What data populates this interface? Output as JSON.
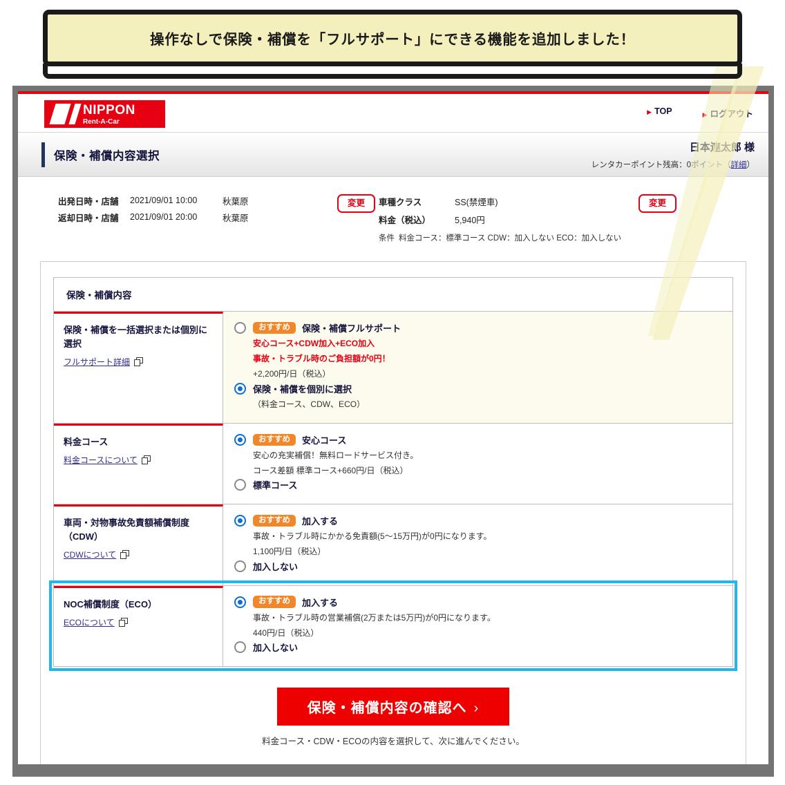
{
  "callout": {
    "text": "操作なしで保険・補償を「フルサポート」にできる機能を追加しました！"
  },
  "header": {
    "logo_line1": "NIPPON",
    "logo_line2": "Rent-A-Car",
    "nav": [
      {
        "label": "TOP"
      },
      {
        "label": "ログアウト"
      }
    ],
    "page_title": "保険・補償内容選択",
    "user_name": "日本連太郎 様",
    "point_text": "レンタカーポイント残高：0ポイント（",
    "point_link": "詳細",
    "point_text_end": "）"
  },
  "summary": {
    "departure_label": "出発日時・店舗",
    "departure_datetime": "2021/09/01 10:00",
    "departure_shop": "秋葉原",
    "return_label": "返却日時・店舗",
    "return_datetime": "2021/09/01 20:00",
    "return_shop": "秋葉原",
    "change_button_1": "変更",
    "change_button_2": "変更",
    "class_label": "車種クラス",
    "class_value": "SS(禁煙車)",
    "fee_label": "料金（税込）",
    "fee_value": "5,940円",
    "conditions_key": "条件",
    "conditions_value": "料金コース：標準コース  CDW：加入しない  ECO：加入しない"
  },
  "card": {
    "section_title": "保険・補償内容",
    "rows": [
      {
        "label_title": "保険・補償を一括選択または個別に選択",
        "link_label": "フルサポート詳細",
        "tinted": true,
        "focused": false,
        "choices": [
          {
            "selected": false,
            "badge": "おすすめ",
            "title": "保険・補償フルサポート",
            "sub": [
              {
                "text": "安心コース+CDW加入+ECO加入",
                "red": true
              },
              {
                "text": "事故・トラブル時のご負担額が0円！",
                "red": true
              },
              {
                "text": "+2,200円/日（税込）",
                "red": false
              }
            ]
          },
          {
            "selected": true,
            "badge": "",
            "title": "保険・補償を個別に選択",
            "sub": [
              {
                "text": "（料金コース、CDW、ECO）",
                "red": false
              }
            ]
          }
        ]
      },
      {
        "label_title": "料金コース",
        "link_label": "料金コースについて",
        "tinted": false,
        "focused": false,
        "choices": [
          {
            "selected": true,
            "badge": "おすすめ",
            "title": "安心コース",
            "sub": [
              {
                "text": "安心の充実補償！無料ロードサービス付き。",
                "red": false
              },
              {
                "text": "コース差額 標準コース+660円/日（税込）",
                "red": false
              }
            ]
          },
          {
            "selected": false,
            "badge": "",
            "title": "標準コース",
            "sub": []
          }
        ]
      },
      {
        "label_title": "車両・対物事故免責額補償制度（CDW）",
        "link_label": "CDWについて",
        "tinted": false,
        "focused": false,
        "choices": [
          {
            "selected": true,
            "badge": "おすすめ",
            "title": "加入する",
            "sub": [
              {
                "text": "事故・トラブル時にかかる免責額(5〜15万円)が0円になります。",
                "red": false
              },
              {
                "text": "1,100円/日（税込）",
                "red": false
              }
            ]
          },
          {
            "selected": false,
            "badge": "",
            "title": "加入しない",
            "sub": []
          }
        ]
      },
      {
        "label_title": "NOC補償制度（ECO）",
        "link_label": "ECOについて",
        "tinted": false,
        "focused": true,
        "choices": [
          {
            "selected": true,
            "badge": "おすすめ",
            "title": "加入する",
            "sub": [
              {
                "text": "事故・トラブル時の営業補償(2万または5万円)が0円になります。",
                "red": false
              },
              {
                "text": "440円/日（税込）",
                "red": false
              }
            ]
          },
          {
            "selected": false,
            "badge": "",
            "title": "加入しない",
            "sub": []
          }
        ]
      }
    ],
    "cta_label": "保険・補償内容の確認へ",
    "cta_arrow": "›",
    "cta_note": "料金コース・CDW・ECOの内容を選択して、次に進んでください。"
  },
  "colors": {
    "brand_red": "#e60012",
    "cta_red": "#ee0000",
    "badge_orange": "#f0872a",
    "radio_blue": "#0b6fd4",
    "focus_cyan": "#22b6f0",
    "callout_yellow": "#f4f0bd",
    "frame_gray": "#747474",
    "title_navy": "#22355e"
  }
}
